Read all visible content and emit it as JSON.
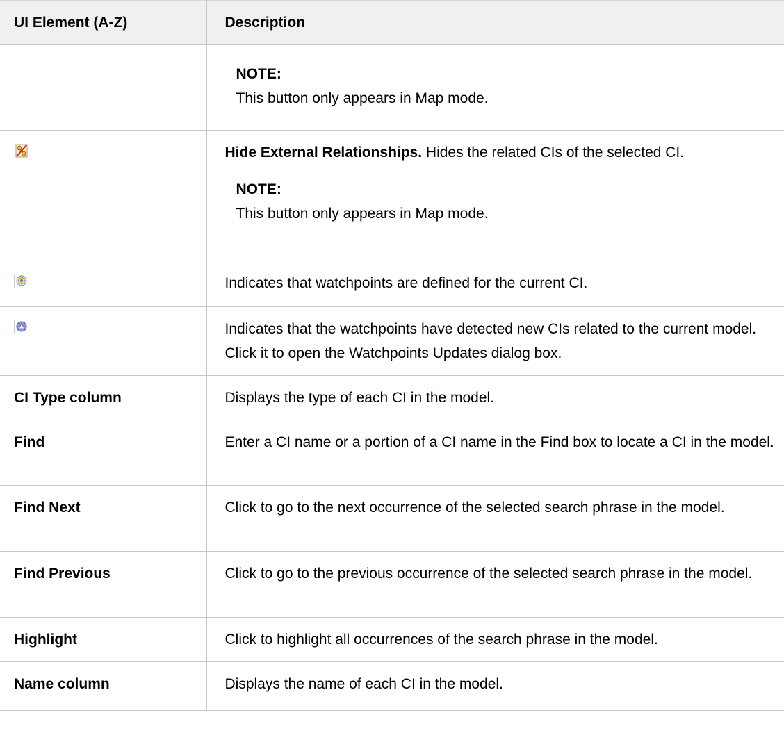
{
  "header": {
    "col1": "UI Element (A-Z)",
    "col2": "Description"
  },
  "rows": [
    {
      "element": "",
      "note_label": "NOTE:",
      "note_text": "This button only appears in Map mode."
    },
    {
      "icon": "hide-external-relationships-icon",
      "title": "Hide External Relationships.",
      "text": " Hides the related CIs of the selected CI.",
      "note_label": "NOTE:",
      "note_text": "This button only appears in Map mode."
    },
    {
      "icon": "watchpoints-defined-icon",
      "text": "Indicates that watchpoints are defined for the current CI."
    },
    {
      "icon": "watchpoints-updates-icon",
      "text": "Indicates that the watchpoints have detected new CIs related to the current model. Click it to open the Watchpoints Updates dialog box."
    },
    {
      "element": "CI Type column",
      "text": "Displays the type of each CI in the model."
    },
    {
      "element": "Find",
      "text": "Enter a CI name or a portion of a CI name in the Find box to locate a CI in the model."
    },
    {
      "element": "Find Next",
      "text": "Click to go to the next occurrence of the selected search phrase in the model."
    },
    {
      "element": "Find Previous",
      "text": "Click to go to the previous occurrence of the selected search phrase in the model."
    },
    {
      "element": "Highlight",
      "text": "Click to highlight all occurrences of the search phrase in the model."
    },
    {
      "element": "Name column",
      "text": "Displays the name of each CI in the model."
    }
  ],
  "colors": {
    "header_bg": "#f0f0f0",
    "border": "#c8c8c8"
  }
}
